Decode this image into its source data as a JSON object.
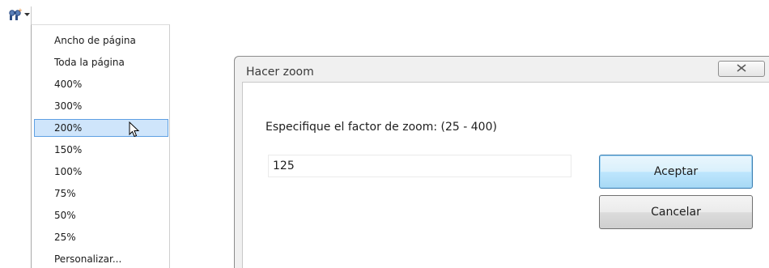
{
  "zoom_dropdown": {
    "button_icon": "zoom-icon",
    "arrow_icon": "chevron-down-icon",
    "items": [
      {
        "label": "Ancho de página",
        "selected": false
      },
      {
        "label": "Toda la página",
        "selected": false
      },
      {
        "label": "400%",
        "selected": false
      },
      {
        "label": "300%",
        "selected": false
      },
      {
        "label": "200%",
        "selected": true
      },
      {
        "label": "150%",
        "selected": false
      },
      {
        "label": "100%",
        "selected": false
      },
      {
        "label": "75%",
        "selected": false
      },
      {
        "label": "50%",
        "selected": false
      },
      {
        "label": "25%",
        "selected": false
      },
      {
        "label": "Personalizar...",
        "selected": false
      }
    ],
    "highlight_color": "#cfe5fb",
    "highlight_border": "#5ea0e3"
  },
  "dialog": {
    "title": "Hacer zoom",
    "close_symbol": "☒",
    "prompt": "Especifique el factor de zoom: (25 - 400)",
    "input_value": "125",
    "ok_label": "Aceptar",
    "cancel_label": "Cancelar"
  }
}
